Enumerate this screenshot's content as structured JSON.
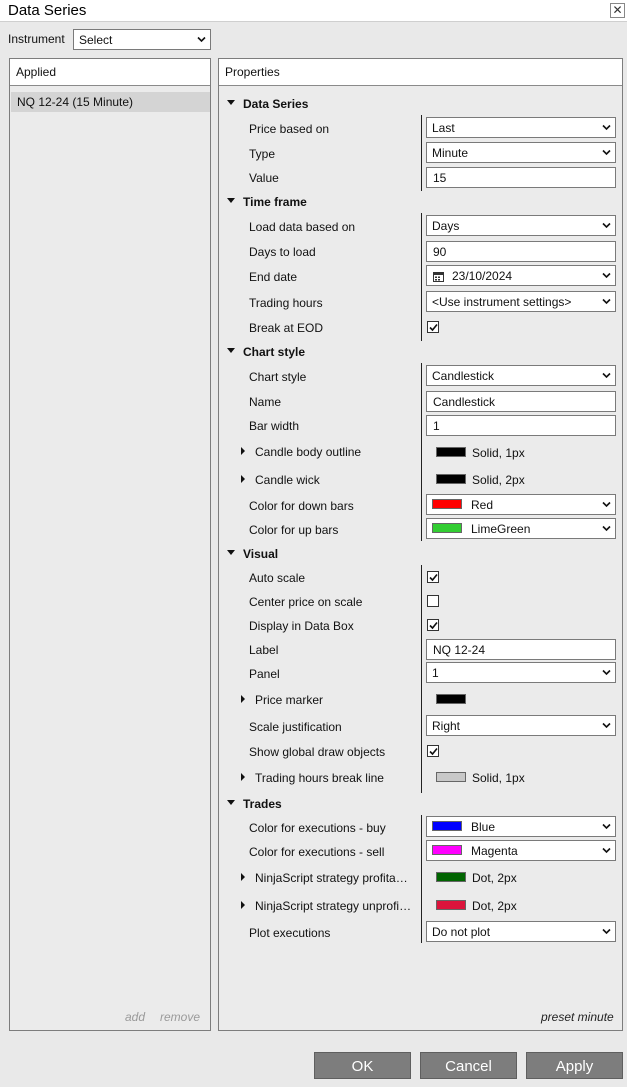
{
  "window": {
    "title": "Data Series",
    "close": "✕"
  },
  "instrument": {
    "label": "Instrument",
    "value": "Select"
  },
  "applied": {
    "header": "Applied",
    "items": [
      "NQ 12-24 (15 Minute)"
    ],
    "add": "add",
    "remove": "remove"
  },
  "properties": {
    "header": "Properties",
    "preset": "preset minute",
    "data_series": {
      "title": "Data Series",
      "price_based_on": {
        "label": "Price based on",
        "value": "Last"
      },
      "type": {
        "label": "Type",
        "value": "Minute"
      },
      "value": {
        "label": "Value",
        "value": "15"
      }
    },
    "time_frame": {
      "title": "Time frame",
      "load_data_based_on": {
        "label": "Load data based on",
        "value": "Days"
      },
      "days_to_load": {
        "label": "Days to load",
        "value": "90"
      },
      "end_date": {
        "label": "End date",
        "value": "23/10/2024"
      },
      "trading_hours": {
        "label": "Trading hours",
        "value": "<Use instrument settings>"
      },
      "break_at_eod": {
        "label": "Break at EOD",
        "checked": true
      }
    },
    "chart_style": {
      "title": "Chart style",
      "chart_style": {
        "label": "Chart style",
        "value": "Candlestick"
      },
      "name": {
        "label": "Name",
        "value": "Candlestick"
      },
      "bar_width": {
        "label": "Bar width",
        "value": "1"
      },
      "candle_body_outline": {
        "label": "Candle body outline",
        "value": "Solid, 1px",
        "color": "#000000"
      },
      "candle_wick": {
        "label": "Candle wick",
        "value": "Solid, 2px",
        "color": "#000000"
      },
      "down_bars": {
        "label": "Color for down bars",
        "value": "Red",
        "color": "#ff0000"
      },
      "up_bars": {
        "label": "Color for up bars",
        "value": "LimeGreen",
        "color": "#32cd32"
      }
    },
    "visual": {
      "title": "Visual",
      "auto_scale": {
        "label": "Auto scale",
        "checked": true
      },
      "center_price": {
        "label": "Center price on scale",
        "checked": false
      },
      "display_in_data_box": {
        "label": "Display in Data Box",
        "checked": true
      },
      "label": {
        "label": "Label",
        "value": "NQ 12-24"
      },
      "panel": {
        "label": "Panel",
        "value": "1"
      },
      "price_marker": {
        "label": "Price marker",
        "color": "#000000"
      },
      "scale_justification": {
        "label": "Scale justification",
        "value": "Right"
      },
      "show_global_draw": {
        "label": "Show global draw objects",
        "checked": true
      },
      "trading_hours_break_line": {
        "label": "Trading hours break line",
        "value": "Solid, 1px",
        "color": "#c8c8c8"
      }
    },
    "trades": {
      "title": "Trades",
      "exec_buy": {
        "label": "Color for executions - buy",
        "value": "Blue",
        "color": "#0000ff"
      },
      "exec_sell": {
        "label": "Color for executions - sell",
        "value": "Magenta",
        "color": "#ff00ff"
      },
      "strategy_profit": {
        "label": "NinjaScript strategy profita…",
        "value": "Dot, 2px",
        "color": "#006400"
      },
      "strategy_unprofit": {
        "label": "NinjaScript strategy unprofi…",
        "value": "Dot, 2px",
        "color": "#dc143c"
      },
      "plot_executions": {
        "label": "Plot executions",
        "value": "Do not plot"
      }
    }
  },
  "buttons": {
    "ok": "OK",
    "cancel": "Cancel",
    "apply": "Apply"
  }
}
